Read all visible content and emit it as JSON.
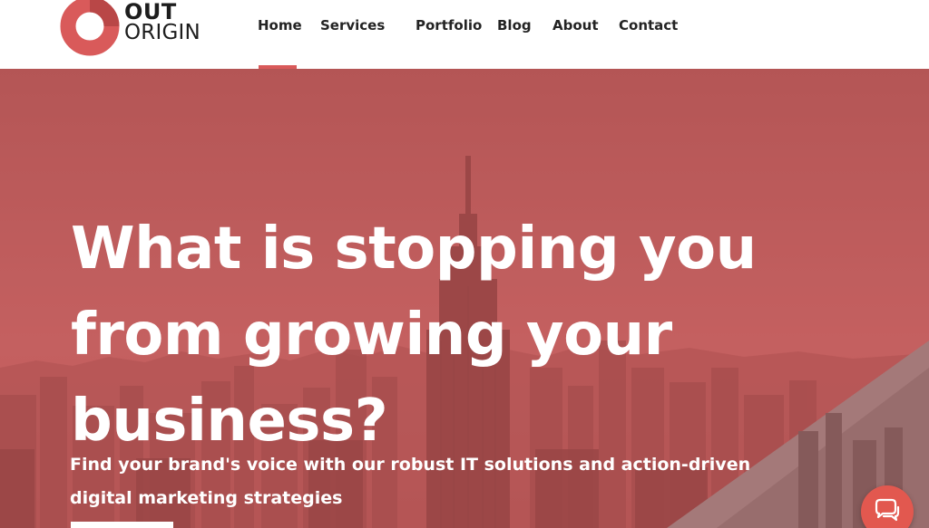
{
  "brand": {
    "line1": "OUT",
    "line2": "ORIGIN",
    "icon": "logo-ring-icon",
    "color": "#d95a5a"
  },
  "nav": {
    "items": [
      {
        "label": "Home",
        "active": true
      },
      {
        "label": "Services",
        "active": false
      },
      {
        "label": "Portfolio",
        "active": false
      },
      {
        "label": "Blog",
        "active": false
      },
      {
        "label": "About",
        "active": false
      },
      {
        "label": "Contact",
        "active": false
      }
    ],
    "active_color": "#d95a5a"
  },
  "hero": {
    "headline_lines": [
      "What is stopping you",
      "from growing your",
      "business?"
    ],
    "subtext_lines": [
      "Find your brand's voice with our robust IT solutions and action-driven",
      "digital marketing strategies"
    ],
    "overlay_color": "#c75b5b"
  },
  "chat": {
    "icon": "chat-bubbles-icon",
    "color": "#e2584f"
  }
}
